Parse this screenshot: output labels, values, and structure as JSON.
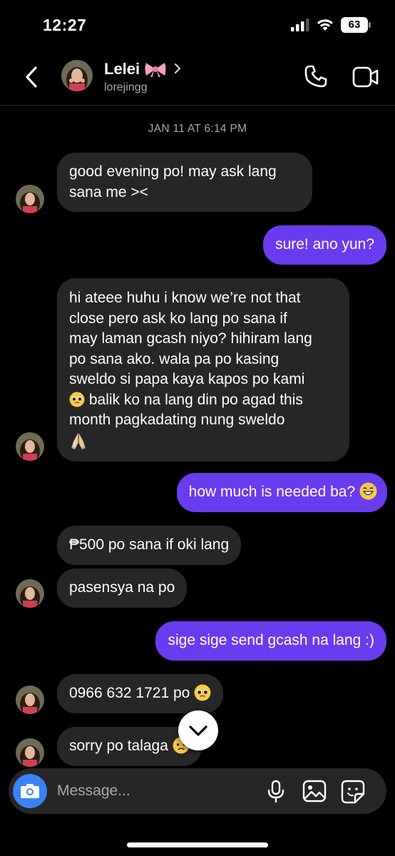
{
  "status_bar": {
    "time": "12:27",
    "battery": "63"
  },
  "header": {
    "name": "Lelei",
    "username": "lorejingg",
    "icons": [
      "back-icon",
      "bow-emoji-icon",
      "chevron-right-icon",
      "phone-icon",
      "video-camera-icon"
    ]
  },
  "date_separator": "JAN 11 AT 6:14 PM",
  "messages": [
    {
      "from": "them",
      "text": "good evening po! may ask lang\nsana me ><"
    },
    {
      "from": "me",
      "text": "sure! ano yun?"
    },
    {
      "from": "them",
      "line1": "hi ateee huhu i know we’re not that",
      "line2": "close pero ask ko lang po sana if",
      "line3": "may laman gcash niyo? hihiram lang",
      "line4": "po sana ako. wala pa po kasing",
      "line5": "sweldo si papa kaya kapos po kami",
      "line6": " balik ko na lang din po agad this",
      "line7": "month pagkadating nung sweldo"
    },
    {
      "from": "me",
      "text": "how much is needed ba? "
    },
    {
      "from": "them",
      "text": "₱500 po sana if oki lang"
    },
    {
      "from": "them",
      "text": "pasensya na po"
    },
    {
      "from": "me",
      "text": "sige sige send gcash na lang :)"
    },
    {
      "from": "them",
      "text": "0966 632 1721 po "
    },
    {
      "from": "them",
      "text": "sorry po talaga "
    }
  ],
  "composer": {
    "placeholder": "Message...",
    "icons": [
      "camera-icon",
      "microphone-icon",
      "gallery-icon",
      "sticker-icon"
    ]
  },
  "colors": {
    "outgoing_bubble": "#6a3cf0",
    "incoming_bubble": "#262626",
    "camera_button": "#3b82f6"
  }
}
